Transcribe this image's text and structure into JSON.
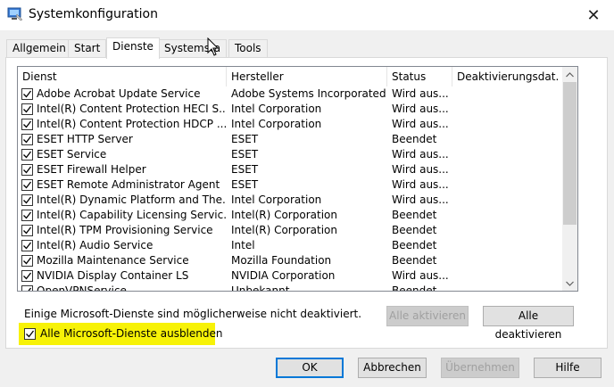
{
  "window": {
    "title": "Systemkonfiguration",
    "close_glyph": "✕"
  },
  "tabs": [
    {
      "label": "Allgemein"
    },
    {
      "label": "Start"
    },
    {
      "label": "Dienste"
    },
    {
      "label": "Systemsta"
    },
    {
      "label": "Tools"
    }
  ],
  "active_tab": "Dienste",
  "services": {
    "columns": [
      "Dienst",
      "Hersteller",
      "Status",
      "Deaktivierungsdat..."
    ],
    "rows": [
      {
        "name": "Adobe Acrobat Update Service",
        "vendor": "Adobe Systems Incorporated",
        "status": "Wird aus...",
        "checked": true
      },
      {
        "name": "Intel(R) Content Protection HECI S...",
        "vendor": "Intel Corporation",
        "status": "Wird aus...",
        "checked": true
      },
      {
        "name": "Intel(R) Content Protection HDCP ...",
        "vendor": "Intel Corporation",
        "status": "Wird aus...",
        "checked": true
      },
      {
        "name": "ESET HTTP Server",
        "vendor": "ESET",
        "status": "Beendet",
        "checked": true
      },
      {
        "name": "ESET Service",
        "vendor": "ESET",
        "status": "Wird aus...",
        "checked": true
      },
      {
        "name": "ESET Firewall Helper",
        "vendor": "ESET",
        "status": "Wird aus...",
        "checked": true
      },
      {
        "name": "ESET Remote Administrator Agent",
        "vendor": "ESET",
        "status": "Wird aus...",
        "checked": true
      },
      {
        "name": "Intel(R) Dynamic Platform and The...",
        "vendor": "Intel Corporation",
        "status": "Wird aus...",
        "checked": true
      },
      {
        "name": "Intel(R) Capability Licensing Servic...",
        "vendor": "Intel(R) Corporation",
        "status": "Beendet",
        "checked": true
      },
      {
        "name": "Intel(R) TPM Provisioning Service",
        "vendor": "Intel(R) Corporation",
        "status": "Beendet",
        "checked": true
      },
      {
        "name": "Intel(R) Audio Service",
        "vendor": "Intel",
        "status": "Beendet",
        "checked": true
      },
      {
        "name": "Mozilla Maintenance Service",
        "vendor": "Mozilla Foundation",
        "status": "Beendet",
        "checked": true
      },
      {
        "name": "NVIDIA Display Container LS",
        "vendor": "NVIDIA Corporation",
        "status": "Wird aus...",
        "checked": true
      },
      {
        "name": "OpenVPNService",
        "vendor": "Unbekannt",
        "status": "Beendet",
        "checked": true
      }
    ]
  },
  "notice": "Einige Microsoft-Dienste sind möglicherweise nicht deaktiviert.",
  "enable_all_button": "Alle aktivieren",
  "disable_all_button": "Alle deaktivieren",
  "hide_ms_checkbox": {
    "label": "Alle Microsoft-Dienste ausblenden",
    "checked": true,
    "highlight_color": "#f7f207"
  },
  "footer": {
    "ok": "OK",
    "cancel": "Abbrechen",
    "apply": "Übernehmen",
    "help": "Hilfe"
  },
  "colors": {
    "accent": "#0078d7"
  }
}
